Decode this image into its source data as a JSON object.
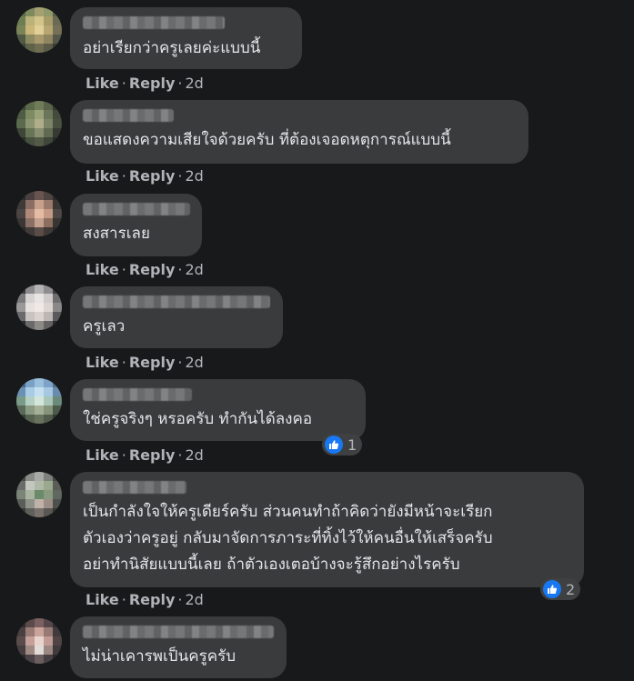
{
  "actions": {
    "like": "Like",
    "reply": "Reply"
  },
  "comments": [
    {
      "text": "อย่าเรียกว่าครูเลยค่ะแบบนี้",
      "time": "2d",
      "reactions": ""
    },
    {
      "text": "ขอแสดงความเสียใจด้วยครับ ที่ต้องเจอดหตุการณ์แบบนี้",
      "time": "2d",
      "reactions": ""
    },
    {
      "text": "สงสารเลย",
      "time": "2d",
      "reactions": ""
    },
    {
      "text": "ครูเลว",
      "time": "2d",
      "reactions": ""
    },
    {
      "text": "ใช่ครูจริงๆ หรอครับ ทำกันได้ลงคอ",
      "time": "2d",
      "reactions": "1"
    },
    {
      "text": "เป็นกำลังใจให้ครูเดียร์ครับ ส่วนคนทำถ้าคิดว่ายังมีหน้าจะเรียก\nตัวเองว่าครูอยู่ กลับมาจัดการภาระที่ทิ้งไว้ให้คนอื่นให้เสร็จครับ\nอย่าทำนิสัยแบบนี้เลย ถ้าตัวเองเตอบ้างจะรู้สึกอย่างไรครับ",
      "time": "2d",
      "reactions": "2"
    },
    {
      "text": "ไม่น่าเคารพเป็นครูครับ",
      "time": "",
      "reactions": ""
    }
  ]
}
